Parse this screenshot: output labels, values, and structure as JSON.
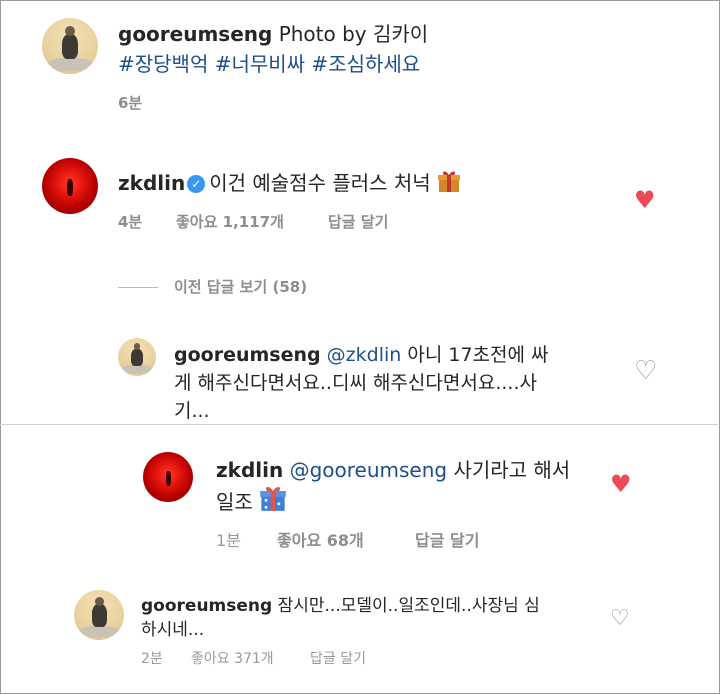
{
  "caption": {
    "username": "gooreumseng",
    "text": "Photo by 김카이",
    "hashtags": "#장당백억 #너무비싸 #조심하세요",
    "time": "6분"
  },
  "comment1": {
    "username": "zkdlin",
    "text": "이건 예술점수 플러스 처넉",
    "time": "4분",
    "likes": "좋아요 1,117개",
    "reply": "답글 달기"
  },
  "view_replies": "이전 답글 보기 (58)",
  "reply1": {
    "username": "gooreumseng",
    "mention": "@zkdlin",
    "text_line1": "아니 17초전에 싸",
    "text_line2": "게 해주신다면서요..디씨 해주신다면서요....사",
    "text_line3": "기..."
  },
  "reply2": {
    "username": "zkdlin",
    "mention": "@gooreumseng",
    "text_line1": "사기라고 해서",
    "text_line2": "일조",
    "time": "1분",
    "likes": "좋아요 68개",
    "reply": "답글 달기"
  },
  "reply3": {
    "username": "gooreumseng",
    "text_line1": "잠시만...모델이..일조인데..사장님 심",
    "text_line2": "하시네...",
    "time": "2분",
    "likes": "좋아요 371개",
    "reply": "답글 달기"
  },
  "icons": {
    "heart_filled": "♥",
    "heart_outline": "♡",
    "verified": "✓"
  },
  "colors": {
    "hashtag": "#1d4e8f",
    "heart": "#ed4956",
    "verified": "#3897f0"
  }
}
